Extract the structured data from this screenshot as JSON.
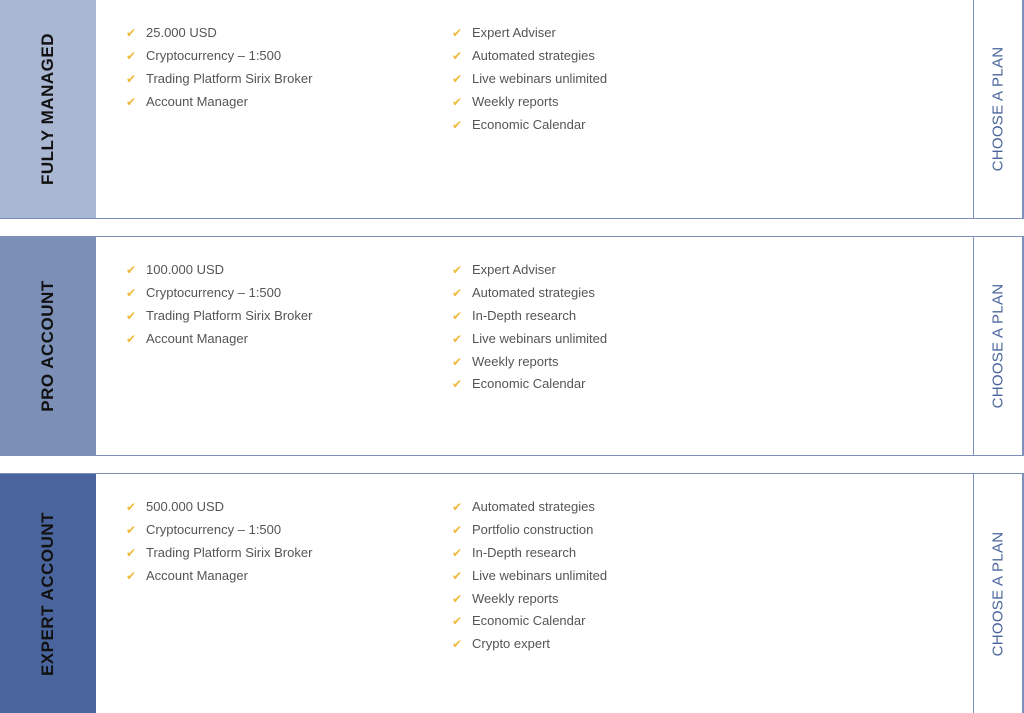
{
  "plans": [
    {
      "title": "FULLY MANAGED",
      "band_color": "#aab7d3",
      "features_left": [
        "25.000 USD",
        "Cryptocurrency – 1:500",
        "Trading Platform Sirix Broker",
        "Account Manager"
      ],
      "features_right": [
        "Expert Adviser",
        "Automated strategies",
        "Live webinars unlimited",
        "Weekly reports",
        "Economic Calendar"
      ],
      "cta": "CHOOSE A PLAN"
    },
    {
      "title": "PRO ACCOUNT",
      "band_color": "#7b8fb7",
      "features_left": [
        "100.000 USD",
        "Cryptocurrency – 1:500",
        "Trading Platform Sirix Broker",
        "Account Manager"
      ],
      "features_right": [
        "Expert Adviser",
        "Automated strategies",
        "In-Depth research",
        "Live webinars unlimited",
        "Weekly reports",
        "Economic Calendar"
      ],
      "cta": "CHOOSE A PLAN"
    },
    {
      "title": "EXPERT ACCOUNT",
      "band_color": "#4a659d",
      "features_left": [
        "500.000 USD",
        "Cryptocurrency – 1:500",
        "Trading Platform Sirix Broker",
        "Account Manager"
      ],
      "features_right": [
        "Automated strategies",
        "Portfolio construction",
        "In-Depth research",
        "Live webinars unlimited",
        "Weekly reports",
        "Economic Calendar",
        "Crypto expert"
      ],
      "cta": "CHOOSE A PLAN"
    }
  ],
  "icons": {
    "feature_bullet": "check-icon",
    "check_glyph": "✔"
  },
  "colors": {
    "check": "#f0b93b",
    "border": "#7d90bb",
    "cta_text": "#4a659d",
    "text": "#555555"
  }
}
